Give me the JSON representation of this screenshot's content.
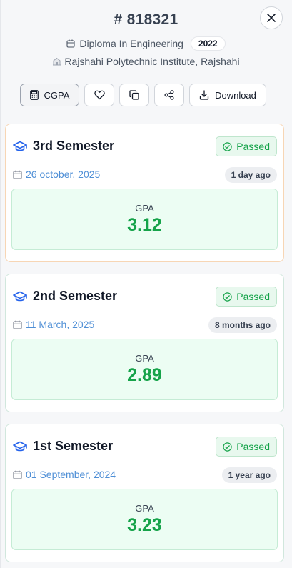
{
  "header": {
    "roll": "# 818321",
    "program": "Diploma In Engineering",
    "year": "2022",
    "institute": "Rajshahi Polytechnic Institute, Rajshahi"
  },
  "toolbar": {
    "cgpa_label": "CGPA",
    "download_label": "Download"
  },
  "semesters": [
    {
      "title": "3rd Semester",
      "status": "Passed",
      "date": "26 october, 2025",
      "ago": "1 day ago",
      "gpa_label": "GPA",
      "gpa": "3.12"
    },
    {
      "title": "2nd Semester",
      "status": "Passed",
      "date": "11 March, 2025",
      "ago": "8 months ago",
      "gpa_label": "GPA",
      "gpa": "2.89"
    },
    {
      "title": "1st Semester",
      "status": "Passed",
      "date": "01 September, 2024",
      "ago": "1 year ago",
      "gpa_label": "GPA",
      "gpa": "3.23"
    }
  ],
  "colors": {
    "accent_blue": "#2563eb",
    "pass_green": "#16a34a",
    "active_border": "#f7d6b5"
  },
  "icons": [
    "close-icon",
    "calendar-icon",
    "building-icon",
    "calculator-icon",
    "heart-icon",
    "copy-icon",
    "share-icon",
    "download-icon",
    "graduation-cap-icon",
    "check-circle-icon"
  ]
}
